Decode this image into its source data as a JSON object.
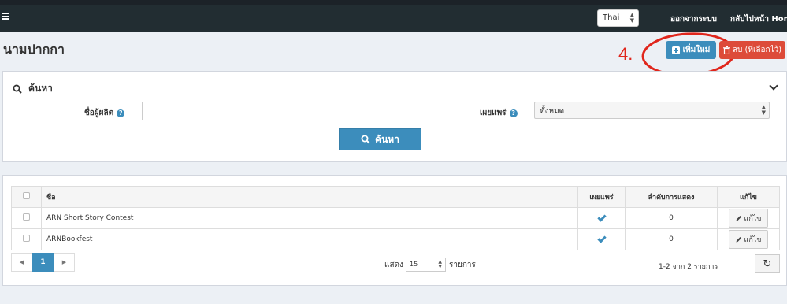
{
  "navbar": {
    "language": "Thai",
    "logout_label": "ออกจากระบบ",
    "home_label": "กลับไปหน้า Home"
  },
  "page": {
    "title": "นามปากกา"
  },
  "toolbar": {
    "add_label": "เพิ่มใหม่",
    "delete_label": "ลบ (ที่เลือกไว้)",
    "annotation_number": "4.",
    "annotation_color": "#e0261c"
  },
  "search": {
    "title": "ค้นหา",
    "publisher_label": "ชื่อผู้ผลิต",
    "publisher_value": "",
    "published_label": "เผยแพร่",
    "published_selected": "ทั้งหมด",
    "submit_label": "ค้นหา"
  },
  "table": {
    "columns": [
      "ชื่อ",
      "เผยแพร่",
      "ลำดับการแสดง",
      "แก้ไข"
    ],
    "rows": [
      {
        "name": "ARN Short Story Contest",
        "published": true,
        "order": "0",
        "edit_label": "แก้ไข"
      },
      {
        "name": "ARNBookfest",
        "published": true,
        "order": "0",
        "edit_label": "แก้ไข"
      }
    ]
  },
  "pagination": {
    "current_page": "1",
    "show_label": "แสดง",
    "per_page": "15",
    "items_label": "รายการ",
    "summary": "1-2 จาก 2 รายการ"
  },
  "colors": {
    "primary": "#3c8dbc",
    "danger": "#dd4b39",
    "navbar": "#222d32"
  }
}
